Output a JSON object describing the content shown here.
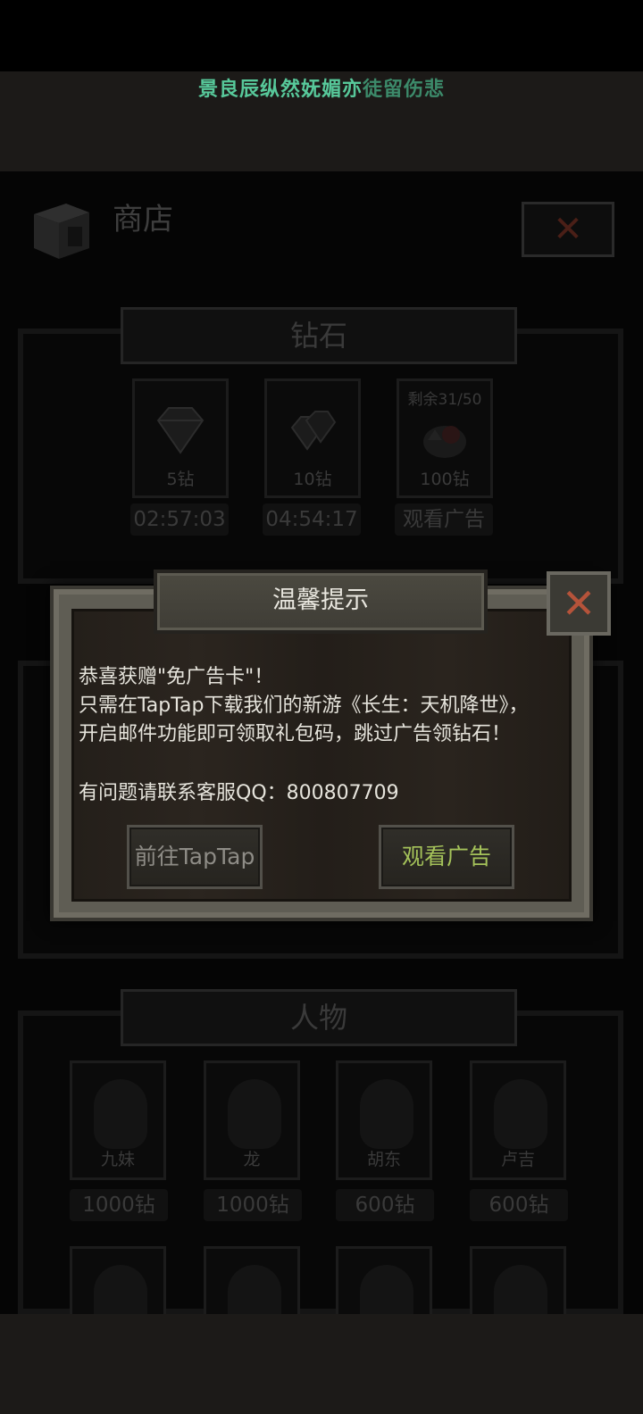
{
  "marquee": {
    "bright": "景良辰纵然妩媚亦",
    "dim": "徒留伤悲"
  },
  "shop": {
    "title": "商店",
    "close_icon": "close-x-icon",
    "diamond_section": {
      "header": "钻石",
      "items": [
        {
          "label": "5钻",
          "top": "",
          "price": "02:57:03"
        },
        {
          "label": "10钻",
          "top": "",
          "price": "04:54:17"
        },
        {
          "label": "100钻",
          "top": "剩余31/50",
          "price": "观看广告"
        }
      ]
    },
    "character_section": {
      "header": "人物",
      "characters": [
        {
          "name": "九妹",
          "price": "1000钻"
        },
        {
          "name": "龙",
          "price": "1000钻"
        },
        {
          "name": "胡东",
          "price": "600钻"
        },
        {
          "name": "卢吉",
          "price": "600钻"
        }
      ]
    }
  },
  "dialog": {
    "title": "温馨提示",
    "lines": [
      "恭喜获赠\"免广告卡\"！",
      "只需在TapTap下载我们的新游《长生：天机降世》，",
      "开启邮件功能即可领取礼包码，跳过广告领钻石！",
      "有问题请联系客服QQ：800807709"
    ],
    "btn_taptap": "前往TapTap",
    "btn_watch": "观看广告"
  },
  "colors": {
    "marquee_bright": "#57c89a",
    "marquee_dim": "#3c8a6a",
    "watch_button_text": "#a5c35a",
    "close_x": "#b5533a"
  }
}
